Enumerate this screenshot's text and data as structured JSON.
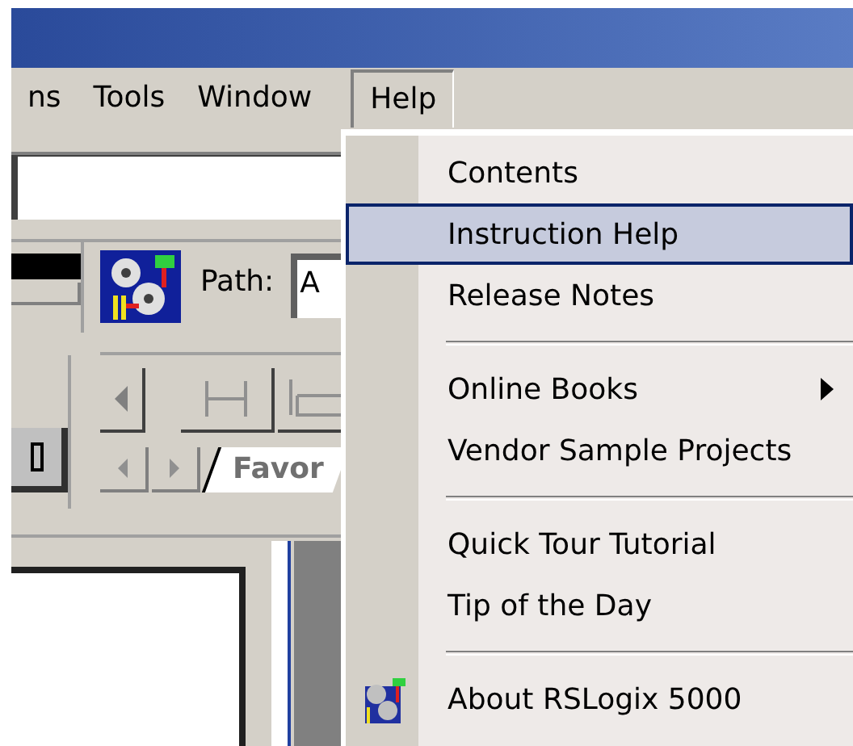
{
  "menu_bar": {
    "items": [
      {
        "label": "ns",
        "open": false
      },
      {
        "label": "Tools",
        "open": false
      },
      {
        "label": "Window",
        "open": false
      },
      {
        "label": "Help",
        "open": true
      }
    ]
  },
  "toolbar": {
    "path_label": "Path:",
    "path_value": "A",
    "tab_label": "Favor"
  },
  "help_menu": {
    "items": [
      {
        "kind": "item",
        "label": "Contents",
        "selected": false
      },
      {
        "kind": "item",
        "label": "Instruction Help",
        "selected": true
      },
      {
        "kind": "item",
        "label": "Release Notes",
        "selected": false
      },
      {
        "kind": "separator"
      },
      {
        "kind": "submenu",
        "label": "Online Books",
        "selected": false
      },
      {
        "kind": "item",
        "label": "Vendor Sample Projects",
        "selected": false
      },
      {
        "kind": "separator"
      },
      {
        "kind": "item",
        "label": "Quick Tour Tutorial",
        "selected": false
      },
      {
        "kind": "item",
        "label": "Tip of the Day",
        "selected": false
      },
      {
        "kind": "separator"
      },
      {
        "kind": "icon_item",
        "label": "About RSLogix 5000",
        "selected": false
      }
    ]
  }
}
